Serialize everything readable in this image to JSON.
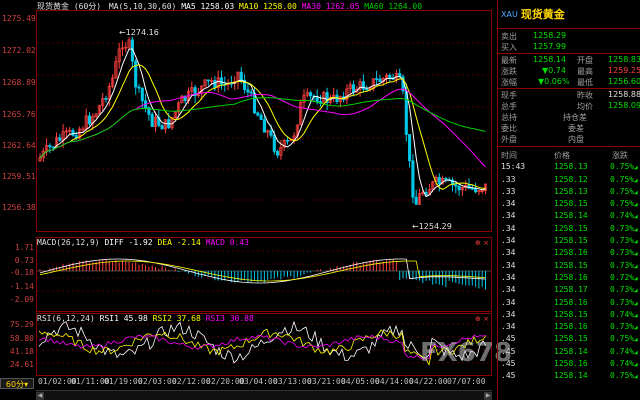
{
  "main_panel": {
    "title": "现货黄金 (60分)",
    "ma_legend": {
      "label": "MA(5,10,30,60)",
      "ma5": "MA5 1258.03",
      "ma10": "MA10 1258.00",
      "ma30": "MA30 1262.05",
      "ma60": "MA60 1264.00"
    },
    "y_labels": [
      "1275.49",
      "1272.02",
      "1268.89",
      "1265.76",
      "1262.64",
      "1259.51",
      "1256.38"
    ],
    "high_marker": "1274.16",
    "low_marker": "1254.29"
  },
  "macd_panel": {
    "title": "MACD(26,12,9)",
    "diff": "DIFF -1.92",
    "dea": "DEA -2.14",
    "macd": "MACD 0.43",
    "y_labels": [
      "1.71",
      "0.73",
      "-0.18",
      "-1.14",
      "-2.09"
    ]
  },
  "rsi_panel": {
    "title": "RSI(6,12,24)",
    "rsi1": "RSI1 45.98",
    "rsi2": "RSI2 37.68",
    "rsi3": "RSI3 30.88",
    "y_labels": [
      "75.29",
      "58.80",
      "41.18",
      "24.61"
    ]
  },
  "x_axis": [
    "01/02:00",
    "01/11:00",
    "01/19:00",
    "02/03:00",
    "02/12:00",
    "02/20:00",
    "03/04:00",
    "03/13:00",
    "03/21:00",
    "04/05:00",
    "04/14:00",
    "04/22:00",
    "07/07:00"
  ],
  "period_button": "60分",
  "colors": {
    "up": "#ff4040",
    "down": "#00c8e8",
    "ma5": "#ffffff",
    "ma10": "#ffff00",
    "ma30": "#ff00ff",
    "ma60": "#00d000",
    "frame": "#8b0000"
  },
  "quote": {
    "code": "XAU",
    "name": "现货黄金",
    "sell_label": "卖出",
    "sell_value": "1258.29",
    "buy_label": "买入",
    "buy_value": "1257.99",
    "latest_label": "最新",
    "latest_value": "1258.14",
    "open_label": "开盘",
    "open_value": "1258.83",
    "change_label": "涨跌",
    "change_value": "▼0.74",
    "high_label": "最高",
    "high_value": "1259.25",
    "pct_label": "涨幅",
    "pct_value": "▼0.06%",
    "low_label": "最低",
    "low_value": "1256.60",
    "now_vol_label": "现手",
    "now_vol_value": "",
    "prev_close_label": "昨收",
    "prev_close_value": "1258.88",
    "total_vol_label": "总手",
    "total_vol_value": "",
    "avg_label": "均价",
    "avg_value": "1258.09",
    "total_label": "总持",
    "total_value": "",
    "pos_change_label": "持仓差",
    "pos_change_value": "",
    "inner_ratio_label": "委比",
    "inner_ratio_value": "",
    "diff_label": "委差",
    "diff_value": "",
    "outer_label": "外盘",
    "outer_value": "",
    "inner_label": "内盘",
    "inner_value": "",
    "ticks_header": {
      "time": "时间",
      "price": "价格",
      "change": "涨跌"
    },
    "ticks": [
      {
        "time": "15:43",
        "price": "1258.13",
        "change": "0.75%"
      },
      {
        "time": ".33",
        "price": "1258.12",
        "change": "0.75%"
      },
      {
        "time": ".33",
        "price": "1258.13",
        "change": "0.75%"
      },
      {
        "time": ".34",
        "price": "1258.15",
        "change": "0.75%"
      },
      {
        "time": ".34",
        "price": "1258.14",
        "change": "0.74%"
      },
      {
        "time": ".34",
        "price": "1258.15",
        "change": "0.73%"
      },
      {
        "time": ".34",
        "price": "1258.15",
        "change": "0.73%"
      },
      {
        "time": ".34",
        "price": "1258.16",
        "change": "0.73%"
      },
      {
        "time": ".34",
        "price": "1258.15",
        "change": "0.73%"
      },
      {
        "time": ".34",
        "price": "1258.16",
        "change": "0.72%"
      },
      {
        "time": ".34",
        "price": "1258.17",
        "change": "0.73%"
      },
      {
        "time": ".34",
        "price": "1258.16",
        "change": "0.73%"
      },
      {
        "time": ".34",
        "price": "1258.15",
        "change": "0.74%"
      },
      {
        "time": ".34",
        "price": "1258.16",
        "change": "0.73%"
      },
      {
        "time": ".45",
        "price": "1258.15",
        "change": "0.75%"
      },
      {
        "time": ".45",
        "price": "1258.14",
        "change": "0.74%"
      },
      {
        "time": ".45",
        "price": "1258.16",
        "change": "0.74%"
      },
      {
        "time": ".45",
        "price": "1258.14",
        "change": "0.75%"
      }
    ]
  },
  "watermark": "FX678"
}
